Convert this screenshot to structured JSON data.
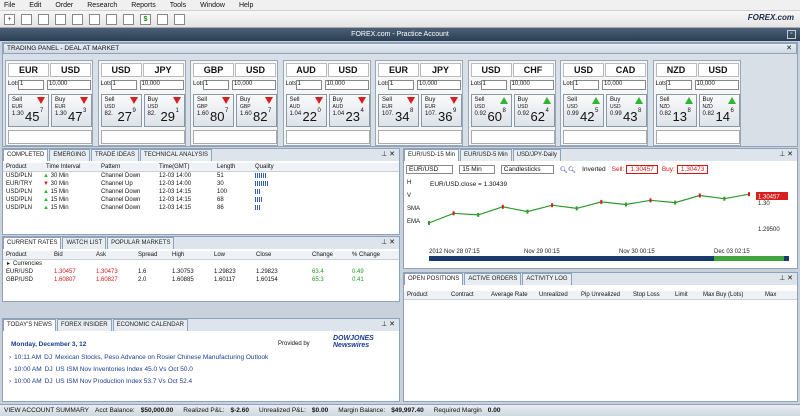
{
  "menu": [
    "File",
    "Edit",
    "Order",
    "Research",
    "Reports",
    "Tools",
    "Window",
    "Help"
  ],
  "logo": "FOREX.com",
  "window_title": "FOREX.com - Practice Account",
  "trading_panel": {
    "title": "TRADING PANEL - DEAL AT MARKET",
    "tiles": [
      {
        "base": "EUR",
        "quote": "USD",
        "lots": "1",
        "amount": "10,000",
        "sell": {
          "ccy": "EUR",
          "big": "1.30",
          "pips": "45",
          "frac": "7",
          "dir": "down"
        },
        "buy": {
          "ccy": "EUR",
          "big": "1.30",
          "pips": "47",
          "frac": "3",
          "dir": "down"
        }
      },
      {
        "base": "USD",
        "quote": "JPY",
        "lots": "1",
        "amount": "10,000",
        "sell": {
          "ccy": "USD",
          "big": "82.",
          "pips": "27",
          "frac": "9",
          "dir": "down"
        },
        "buy": {
          "ccy": "USD",
          "big": "82.",
          "pips": "29",
          "frac": "1",
          "dir": "down"
        }
      },
      {
        "base": "GBP",
        "quote": "USD",
        "lots": "1",
        "amount": "10,000",
        "sell": {
          "ccy": "GBP",
          "big": "1.60",
          "pips": "80",
          "frac": "7",
          "dir": "down"
        },
        "buy": {
          "ccy": "GBP",
          "big": "1.60",
          "pips": "82",
          "frac": "7",
          "dir": "down"
        }
      },
      {
        "base": "AUD",
        "quote": "USD",
        "lots": "1",
        "amount": "10,000",
        "sell": {
          "ccy": "AUD",
          "big": "1.04",
          "pips": "22",
          "frac": "0",
          "dir": "down"
        },
        "buy": {
          "ccy": "AUD",
          "big": "1.04",
          "pips": "23",
          "frac": "4",
          "dir": "down"
        }
      },
      {
        "base": "EUR",
        "quote": "JPY",
        "lots": "1",
        "amount": "10,000",
        "sell": {
          "ccy": "EUR",
          "big": "107.",
          "pips": "34",
          "frac": "8",
          "dir": "down"
        },
        "buy": {
          "ccy": "EUR",
          "big": "107.",
          "pips": "36",
          "frac": "9",
          "dir": "down"
        }
      },
      {
        "base": "USD",
        "quote": "CHF",
        "lots": "1",
        "amount": "10,000",
        "sell": {
          "ccy": "USD",
          "big": "0.92",
          "pips": "60",
          "frac": "8",
          "dir": "up"
        },
        "buy": {
          "ccy": "USD",
          "big": "0.92",
          "pips": "62",
          "frac": "4",
          "dir": "up"
        }
      },
      {
        "base": "USD",
        "quote": "CAD",
        "lots": "1",
        "amount": "10,000",
        "sell": {
          "ccy": "USD",
          "big": "0.99",
          "pips": "42",
          "frac": "5",
          "dir": "up"
        },
        "buy": {
          "ccy": "USD",
          "big": "0.99",
          "pips": "43",
          "frac": "8",
          "dir": "up"
        }
      },
      {
        "base": "NZD",
        "quote": "USD",
        "lots": "1",
        "amount": "10,000",
        "sell": {
          "ccy": "NZD",
          "big": "0.82",
          "pips": "13",
          "frac": "8",
          "dir": "up"
        },
        "buy": {
          "ccy": "NZD",
          "big": "0.82",
          "pips": "14",
          "frac": "6",
          "dir": "up"
        }
      }
    ]
  },
  "patterns": {
    "tabs": [
      "COMPLETED",
      "EMERGING",
      "TRADE IDEAS",
      "TECHNICAL ANALYSIS"
    ],
    "headers": [
      "Product",
      "Time Interval",
      "Pattern",
      "Time(GMT)",
      "Length",
      "Quality"
    ],
    "rows": [
      {
        "product": "USD/PLN",
        "dir": "up",
        "interval": "30 Min",
        "pattern": "Channel Down",
        "time": "12-03 14:00",
        "length": "51",
        "quality": 12
      },
      {
        "product": "EUR/TRY",
        "dir": "down",
        "interval": "30 Min",
        "pattern": "Channel Up",
        "time": "12-03 14:00",
        "length": "30",
        "quality": 14
      },
      {
        "product": "USD/PLN",
        "dir": "up",
        "interval": "15 Min",
        "pattern": "Channel Down",
        "time": "12-03 14:15",
        "length": "100",
        "quality": 6
      },
      {
        "product": "USD/PLN",
        "dir": "up",
        "interval": "15 Min",
        "pattern": "Channel Down",
        "time": "12-03 14:15",
        "length": "68",
        "quality": 8
      },
      {
        "product": "USD/PLN",
        "dir": "up",
        "interval": "15 Min",
        "pattern": "Channel Down",
        "time": "12-03 14:15",
        "length": "86",
        "quality": 6
      }
    ]
  },
  "rates": {
    "tabs": [
      "CURRENT RATES",
      "WATCH LIST",
      "POPULAR MARKETS"
    ],
    "headers": [
      "Product",
      "Bid",
      "Ask",
      "Spread",
      "High",
      "Low",
      "Close",
      "Change",
      "% Change"
    ],
    "group": "Currencies",
    "rows": [
      {
        "product": "EUR/USD",
        "bid": "1.30457",
        "ask": "1.30473",
        "spread": "1.6",
        "high": "1.30753",
        "low": "1.29823",
        "close": "1.29823",
        "change": "63.4",
        "pct": "0.49"
      },
      {
        "product": "GBP/USD",
        "bid": "1.60807",
        "ask": "1.60827",
        "spread": "2.0",
        "high": "1.60885",
        "low": "1.60117",
        "close": "1.60154",
        "change": "65.3",
        "pct": "0.41"
      }
    ]
  },
  "news": {
    "tabs": [
      "TODAY'S NEWS",
      "FOREX INSIDER",
      "ECONOMIC CALENDAR"
    ],
    "provided_by": "Provided by",
    "provider": "DOWJONES Newswires",
    "date": "Monday, December 3, 12",
    "items": [
      {
        "time": "10:11 AM",
        "src": "DJ",
        "text": "Mexican Stocks, Peso Advance on Rosier Chinese Manufacturing Outlook"
      },
      {
        "time": "10:00 AM",
        "src": "DJ",
        "text": "US ISM Nov Inventories Index 45.0 Vs Oct 50.0"
      },
      {
        "time": "10:00 AM",
        "src": "DJ",
        "text": "US ISM Nov Production Index 53.7 Vs Oct 52.4"
      }
    ]
  },
  "chart": {
    "tabs": [
      "EUR/USD-15 Min",
      "EUR/USD-5 Min",
      "USD/JPY-Daily"
    ],
    "symbol": "EUR/USD",
    "interval": "15 Min",
    "style": "Candlesticks",
    "inverted": "Inverted",
    "sell_label": "Sell:",
    "sell": "1.30457",
    "buy_label": "Buy:",
    "buy": "1.30473",
    "legend": "EUR/USD.close = 1.30439",
    "price_tag": "1.30457",
    "side_tools": [
      "H",
      "V",
      "SMA",
      "EMA"
    ],
    "chart_data": {
      "type": "line",
      "x": [
        "2012 Nov 28 07:15",
        "Nov 29 00:15",
        "Nov 30 00:15",
        "Dec 03 02:15"
      ],
      "y": [
        1.2955,
        1.2985,
        1.298,
        1.3005,
        1.299,
        1.301,
        1.3,
        1.302,
        1.3012,
        1.3025,
        1.3018,
        1.304,
        1.303,
        1.3044
      ],
      "yticks": [
        "1.30",
        "1.29500"
      ],
      "ylim": [
        1.289,
        1.306
      ]
    }
  },
  "positions": {
    "tabs": [
      "OPEN POSITIONS",
      "ACTIVE ORDERS",
      "ACTIVITY LOG"
    ],
    "headers": [
      "Product",
      "Contract",
      "Average Rate",
      "Unrealized",
      "Pip Unrealized",
      "Stop Loss",
      "Limit",
      "Max Buy (Lots)",
      "Max"
    ]
  },
  "status": {
    "summary": "VIEW ACCOUNT SUMMARY",
    "acct_label": "Acct Balance:",
    "acct": "$50,000.00",
    "realized_label": "Realized P&L:",
    "realized": "$-2.60",
    "unrealized_label": "Unrealized P&L:",
    "unrealized": "$0.00",
    "margin_label": "Margin Balance:",
    "margin": "$49,997.40",
    "req_label": "Required Margin",
    "req": "0.00"
  },
  "colors": {
    "accent": "#2b3d52",
    "down": "#d81e1e",
    "up": "#2db52d"
  }
}
